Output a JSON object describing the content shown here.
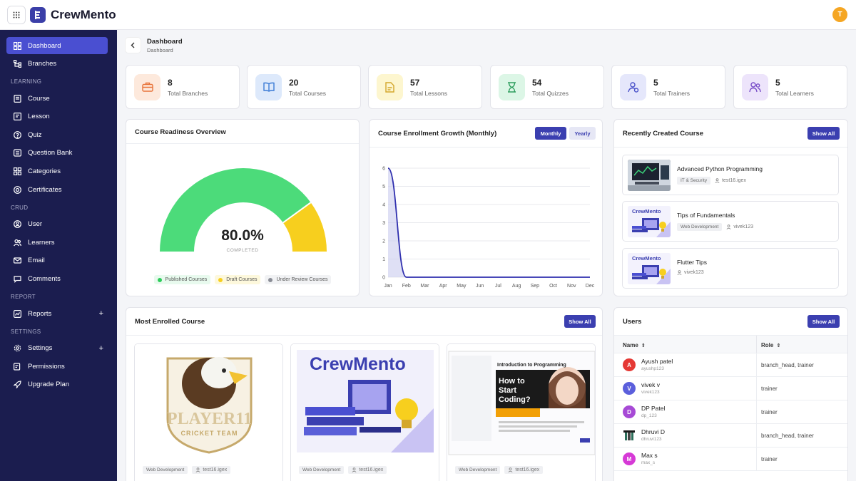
{
  "app": {
    "name": "CrewMento",
    "user_initial": "T"
  },
  "sidebar": {
    "items": [
      {
        "label": "Dashboard",
        "icon": "grid-icon"
      },
      {
        "label": "Branches",
        "icon": "branch-icon"
      }
    ],
    "sections": [
      {
        "title": "LEARNING",
        "items": [
          "Course",
          "Lesson",
          "Quiz",
          "Question Bank",
          "Categories",
          "Certificates"
        ]
      },
      {
        "title": "CRUD",
        "items": [
          "User",
          "Learners",
          "Email",
          "Comments"
        ]
      },
      {
        "title": "REPORT",
        "items": [
          "Reports"
        ]
      },
      {
        "title": "SETTINGS",
        "items": [
          "Settings",
          "Permissions",
          "Upgrade Plan"
        ]
      }
    ]
  },
  "breadcrumb": {
    "title": "Dashboard",
    "sub": "Dashboard"
  },
  "stats": [
    {
      "value": "8",
      "label": "Total Branches",
      "color": "#fde9dc",
      "icon_color": "#e8743b",
      "icon": "briefcase-icon"
    },
    {
      "value": "20",
      "label": "Total Courses",
      "color": "#dde9fb",
      "icon_color": "#3b7bd6",
      "icon": "book-icon"
    },
    {
      "value": "57",
      "label": "Total Lessons",
      "color": "#fdf6cf",
      "icon_color": "#d4a72c",
      "icon": "lesson-icon"
    },
    {
      "value": "54",
      "label": "Total Quizzes",
      "color": "#dcf6e6",
      "icon_color": "#2e9e5e",
      "icon": "hourglass-icon"
    },
    {
      "value": "5",
      "label": "Total Trainers",
      "color": "#e5e7fb",
      "icon_color": "#4a52c9",
      "icon": "trainer-icon"
    },
    {
      "value": "5",
      "label": "Total Learners",
      "color": "#ede4fb",
      "icon_color": "#7a4fc9",
      "icon": "learners-icon"
    }
  ],
  "readiness": {
    "title": "Course Readiness Overview",
    "value": "80.0%",
    "sub": "COMPLETED",
    "percent_published": 80,
    "legend": [
      "Published Courses",
      "Draft Courses",
      "Under Review Courses"
    ],
    "colors": [
      "#4cdb7a",
      "#f7cf1e",
      "#8a8d96"
    ]
  },
  "enrollment": {
    "title": "Course Enrollment Growth (Monthly)",
    "monthly_label": "Monthly",
    "yearly_label": "Yearly"
  },
  "chart_data": {
    "type": "area",
    "categories": [
      "Jan",
      "Feb",
      "Mar",
      "Apr",
      "May",
      "Jun",
      "Jul",
      "Aug",
      "Sep",
      "Oct",
      "Nov",
      "Dec"
    ],
    "values": [
      6,
      0,
      0,
      0,
      0,
      0,
      0,
      0,
      0,
      0,
      0,
      0
    ],
    "ylim": [
      0,
      6
    ],
    "yticks": [
      0,
      1,
      2,
      3,
      4,
      5,
      6
    ],
    "grid": true,
    "color": "#2f2fae"
  },
  "recent": {
    "title": "Recently Created Course",
    "show_all": "Show All",
    "items": [
      {
        "title": "Advanced Python Programming",
        "tag": "IT & Security",
        "user": "test16.igex"
      },
      {
        "title": "Tips of Fundamentals",
        "tag": "Web Development",
        "user": "vivek123"
      },
      {
        "title": "Flutter Tips",
        "tag": "",
        "user": "vivek123"
      }
    ],
    "brand_label": "CrewMento"
  },
  "most_enrolled": {
    "title": "Most Enrolled Course",
    "show_all": "Show All",
    "items": [
      {
        "tag": "Web Development",
        "user": "test16.igex",
        "image_text_1": "PLAYER11",
        "image_text_2": "CRICKET TEAM"
      },
      {
        "tag": "Web Development",
        "user": "test16.igex",
        "image_text_1": "CrewMento",
        "image_text_2": ""
      },
      {
        "tag": "Web Development",
        "user": "test16.igex",
        "image_text_1": "Introduction to Programming",
        "image_text_2": "How to Start Coding?"
      }
    ]
  },
  "users": {
    "title": "Users",
    "show_all": "Show All",
    "col_name": "Name",
    "col_role": "Role",
    "rows": [
      {
        "initial": "A",
        "name": "Ayush patel",
        "handle": "ayushp123",
        "role": "branch_head, trainer",
        "color": "#e53935"
      },
      {
        "initial": "V",
        "name": "vivek v",
        "handle": "vivek123",
        "role": "trainer",
        "color": "#5b5fdc"
      },
      {
        "initial": "D",
        "name": "DP Patel",
        "handle": "dp_123",
        "role": "trainer",
        "color": "#a74ad6"
      },
      {
        "initial": "",
        "name": "Dhruvi D",
        "handle": "dhruvi123",
        "role": "branch_head, trainer",
        "color": "#ffffff"
      },
      {
        "initial": "M",
        "name": "Max s",
        "handle": "max_s",
        "role": "trainer",
        "color": "#d63ad6"
      }
    ]
  }
}
